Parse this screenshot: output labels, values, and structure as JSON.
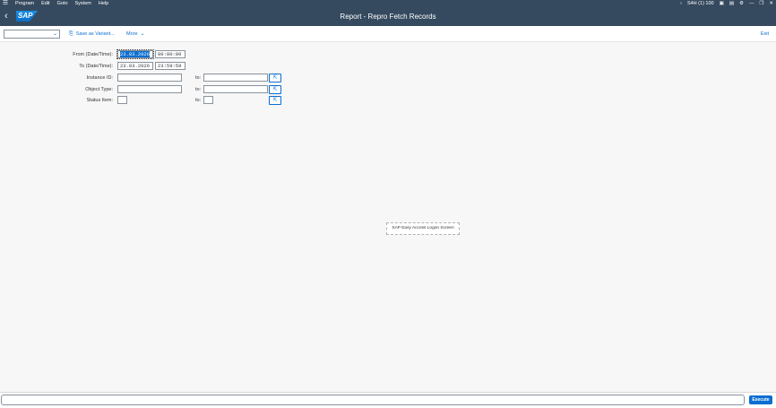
{
  "menubar": {
    "items": [
      "Program",
      "Edit",
      "Goto",
      "System",
      "Help"
    ],
    "session": "S4H (1) 100"
  },
  "header": {
    "title": "Report - Repro Fetch Records"
  },
  "toolbar": {
    "variant_value": "",
    "save_variant": "Save as Variant...",
    "more": "More",
    "exit": "Exit"
  },
  "form": {
    "from_label": "From (Date/Time):",
    "from_date": "23.03.2026",
    "from_time": "00:00:00",
    "to_label": "To (Date/Time):",
    "to_date": "23.03.2026",
    "to_time": "23:59:59",
    "instance_label": "Instance ID:",
    "object_label": "Object Type:",
    "status_label": "Status Item:",
    "to_text": "to:"
  },
  "popover": {
    "text": "SAP Easy Access Logon Screen"
  },
  "footer": {
    "execute": "Execute"
  },
  "colors": {
    "shell": "#354a5f",
    "accent": "#0a6ed1"
  }
}
